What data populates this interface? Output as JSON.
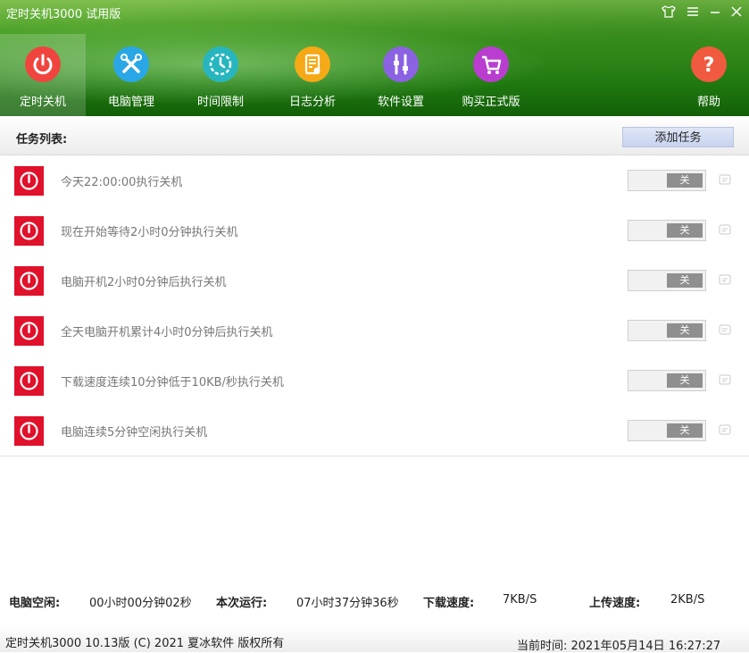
{
  "window": {
    "title": "定时关机3000 试用版",
    "controls": [
      "shirt-icon",
      "menu-icon",
      "minimize-icon",
      "close-icon"
    ]
  },
  "nav": [
    {
      "label": "定时关机",
      "icon": "power-icon",
      "color": "#f0453f",
      "active": true
    },
    {
      "label": "电脑管理",
      "icon": "tools-icon",
      "color": "#2aa7e6",
      "active": false
    },
    {
      "label": "时间限制",
      "icon": "timer-icon",
      "color": "#27b6bf",
      "active": false
    },
    {
      "label": "日志分析",
      "icon": "log-icon",
      "color": "#f6a916",
      "active": false
    },
    {
      "label": "软件设置",
      "icon": "settings-icon",
      "color": "#8a62e2",
      "active": false
    },
    {
      "label": "购买正式版",
      "icon": "cart-icon",
      "color": "#b93ed0",
      "active": false
    },
    {
      "label": "帮助",
      "icon": "help-icon",
      "color": "#f05a3f",
      "active": false
    }
  ],
  "task_list": {
    "title": "任务列表:",
    "add_button": "添加任务",
    "items": [
      {
        "text": "今天22:00:00执行关机",
        "toggle": "关"
      },
      {
        "text": "现在开始等待2小时0分钟执行关机",
        "toggle": "关"
      },
      {
        "text": "电脑开机2小时0分钟后执行关机",
        "toggle": "关"
      },
      {
        "text": "全天电脑开机累计4小时0分钟后执行关机",
        "toggle": "关"
      },
      {
        "text": "下载速度连续10分钟低于10KB/秒执行关机",
        "toggle": "关"
      },
      {
        "text": "电脑连续5分钟空闲执行关机",
        "toggle": "关"
      }
    ]
  },
  "status": {
    "idle_label": "电脑空闲:",
    "idle_value": "00小时00分钟02秒",
    "run_label": "本次运行:",
    "run_value": "07小时37分钟36秒",
    "download_label": "下载速度:",
    "download_value": "7KB/S",
    "upload_label": "上传速度:",
    "upload_value": "2KB/S"
  },
  "footer": {
    "copyright": "定时关机3000 10.13版 (C) 2021  夏冰软件 版权所有",
    "current_time": "当前时间: 2021年05月14日 16:27:27"
  }
}
